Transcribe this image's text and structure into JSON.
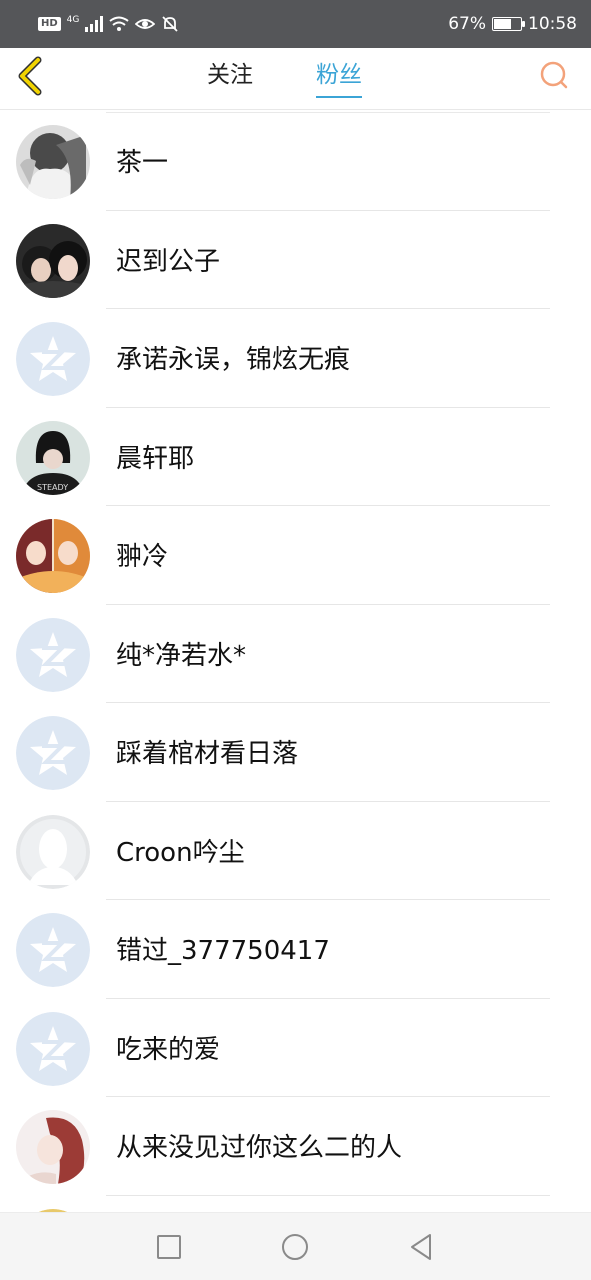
{
  "status_bar": {
    "hd": "HD",
    "network": "4G",
    "battery_percent": "67%",
    "battery_level": 0.67,
    "time": "10:58",
    "icons": [
      "signal-icon",
      "wifi-icon",
      "eye-icon",
      "bell-off-icon",
      "battery-icon"
    ]
  },
  "header": {
    "back_icon": "chevron-left-icon",
    "tabs": [
      {
        "label": "关注",
        "active": false
      },
      {
        "label": "粉丝",
        "active": true
      }
    ],
    "search_icon": "search-icon",
    "accent_color": "#3ba4d6",
    "back_color": "#f1d300",
    "search_color": "#f3a27a"
  },
  "fans": [
    {
      "name": "茶一",
      "avatar": "photo-girl-bw"
    },
    {
      "name": "迟到公子",
      "avatar": "photo-two-people"
    },
    {
      "name": "承诺永误，锦炫无痕",
      "avatar": "qzone-default"
    },
    {
      "name": "晨轩耶",
      "avatar": "photo-short-hair"
    },
    {
      "name": "翀冷",
      "avatar": "anime-girls"
    },
    {
      "name": "纯*净若水*",
      "avatar": "qzone-default"
    },
    {
      "name": "踩着棺材看日落",
      "avatar": "qzone-default"
    },
    {
      "name": "Croon吟尘",
      "avatar": "silhouette-default"
    },
    {
      "name": "错过_377750417",
      "avatar": "qzone-default"
    },
    {
      "name": "吃来的爱",
      "avatar": "qzone-default"
    },
    {
      "name": "从来没见过你这么二的人",
      "avatar": "photo-red-hair-girl"
    },
    {
      "name": "",
      "avatar": "partial"
    }
  ],
  "nav_bar": {
    "recent_icon": "square-icon",
    "home_icon": "circle-icon",
    "back_icon": "triangle-back-icon"
  }
}
